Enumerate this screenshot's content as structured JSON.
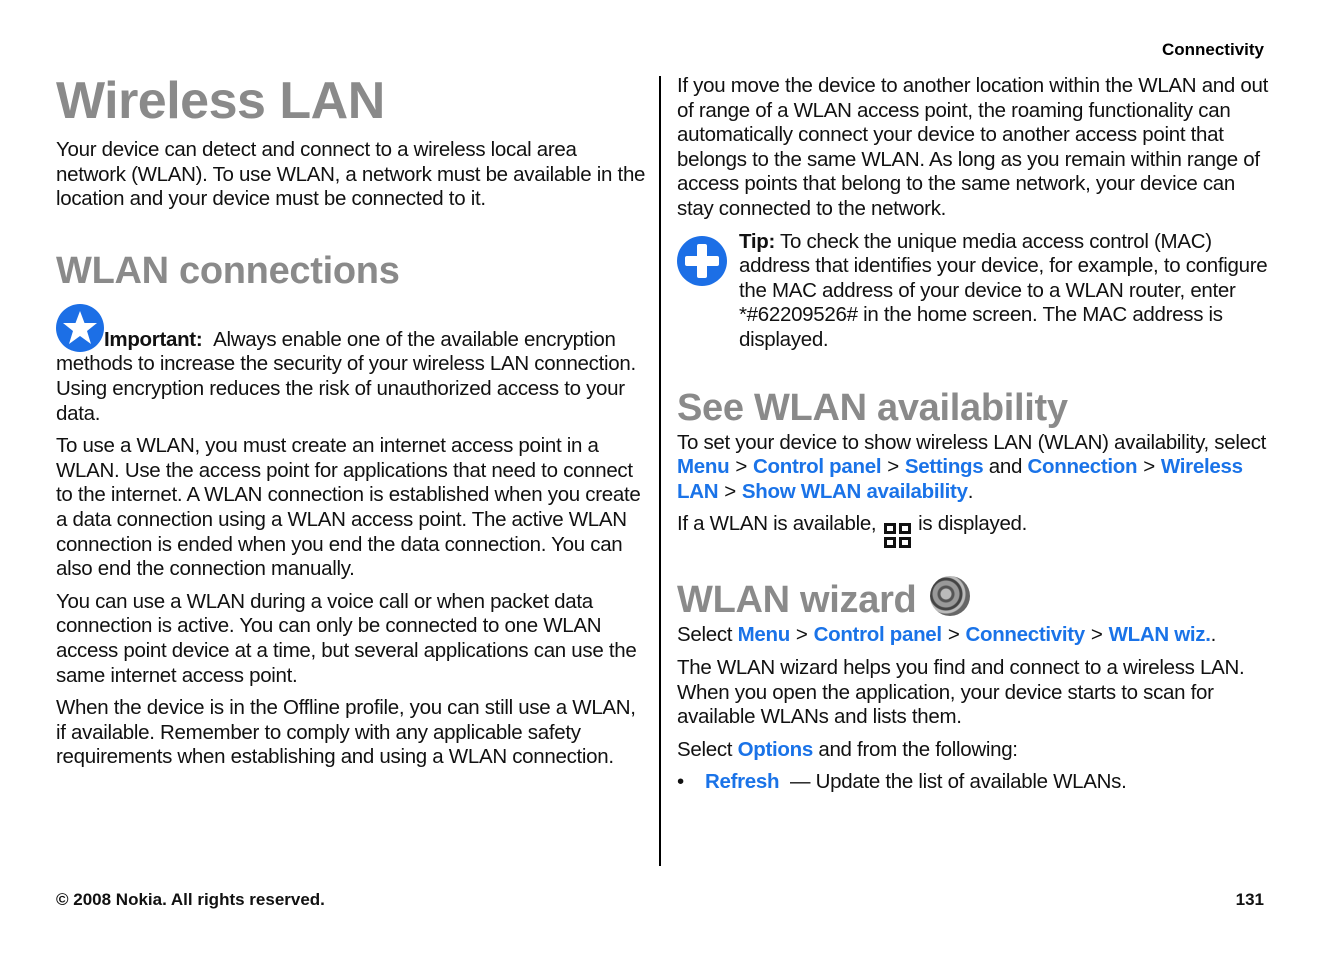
{
  "header": {
    "section": "Connectivity"
  },
  "left": {
    "title": "Wireless LAN",
    "intro": "Your device can detect and connect to a wireless local area network (WLAN). To use WLAN, a network must be available in the location and your device must be connected to it.",
    "wlan_connections": {
      "heading": "WLAN connections",
      "important_label": "Important:",
      "important_text": "Always enable one of the available encryption methods to increase the security of your wireless LAN connection. Using encryption reduces the risk of unauthorized access to your data.",
      "paragraphs": [
        "To use a WLAN, you must create an internet access point in a WLAN. Use the access point for applications that need to connect to the internet. A WLAN connection is established when you create a data connection using a WLAN access point. The active WLAN connection is ended when you end the data connection. You can also end the connection manually.",
        "You can use a WLAN during a voice call or when packet data connection is active. You can only be connected to one WLAN access point device at a time, but several applications can use the same internet access point.",
        "When the device is in the Offline profile, you can still use a WLAN, if available. Remember to comply with any applicable safety requirements when establishing and using a WLAN connection."
      ]
    }
  },
  "right": {
    "roaming": "If you move the device to another location within the WLAN and out of range of a WLAN access point, the roaming functionality can automatically connect your device to another access point that belongs to the same WLAN. As long as you remain within range of access points that belong to the same network, your device can stay connected to the network.",
    "tip_label": "Tip:",
    "tip_text": "To check the unique media access control (MAC) address that identifies your device, for example, to configure the MAC address of your device to a WLAN router, enter *#62209526# in the home screen. The MAC address is displayed.",
    "availability": {
      "heading": "See WLAN availability",
      "intro": "To set your device to show wireless LAN (WLAN) availability, select",
      "path1": [
        "Menu",
        "Control panel",
        "Settings"
      ],
      "and": "and",
      "path2": [
        "Connection",
        "Wireless LAN",
        "Show WLAN availability"
      ],
      "separator": ">",
      "available_before": "If a WLAN is available,",
      "available_after": "is displayed."
    },
    "wizard": {
      "heading": "WLAN wizard",
      "select": "Select",
      "path": [
        "Menu",
        "Control panel",
        "Connectivity",
        "WLAN wiz."
      ],
      "description": "The WLAN wizard helps you find and connect to a wireless LAN. When you open the application, your device starts to scan for available WLANs and lists them.",
      "options_before": "Select",
      "options_link": "Options",
      "options_after": "and from the following:",
      "options": [
        {
          "label": "Refresh",
          "description": "— Update the list of available WLANs."
        }
      ]
    }
  },
  "footer": {
    "copyright": "© 2008 Nokia. All rights reserved.",
    "page_number": "131"
  }
}
